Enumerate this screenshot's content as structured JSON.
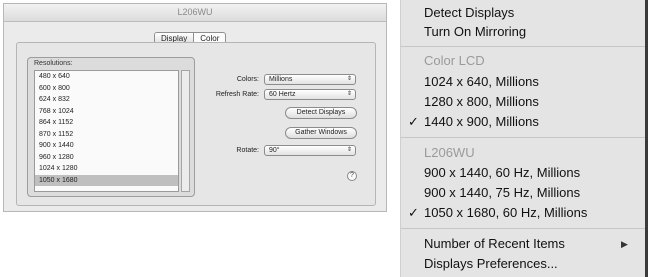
{
  "window": {
    "title": "L206WU",
    "tabs": [
      "Display",
      "Color"
    ],
    "resolutions_label": "Resolutions:",
    "resolutions": [
      "480 x 640",
      "600 x 800",
      "624 x 832",
      "768 x 1024",
      "864 x 1152",
      "870 x 1152",
      "900 x 1440",
      "960 x 1280",
      "1024 x 1280",
      "1050 x 1680"
    ],
    "selected_resolution_index": 9,
    "colors_label": "Colors:",
    "colors_value": "Millions",
    "refresh_label": "Refresh Rate:",
    "refresh_value": "60 Hertz",
    "detect_button": "Detect Displays",
    "gather_button": "Gather Windows",
    "rotate_label": "Rotate:",
    "rotate_value": "90°",
    "help": "?"
  },
  "menu": {
    "detect": "Detect Displays",
    "mirroring": "Turn On Mirroring",
    "section1_title": "Color LCD",
    "section1_items": [
      "1024 x 640, Millions",
      "1280 x 800, Millions",
      "1440 x 900, Millions"
    ],
    "section2_title": "L206WU",
    "section2_items": [
      "900 x 1440, 60 Hz, Millions",
      "900 x 1440, 75 Hz, Millions",
      "1050 x 1680, 60 Hz, Millions"
    ],
    "recent": "Number of Recent Items",
    "prefs": "Displays Preferences...",
    "checkmark": "✓",
    "submenu_arrow": "▶"
  }
}
